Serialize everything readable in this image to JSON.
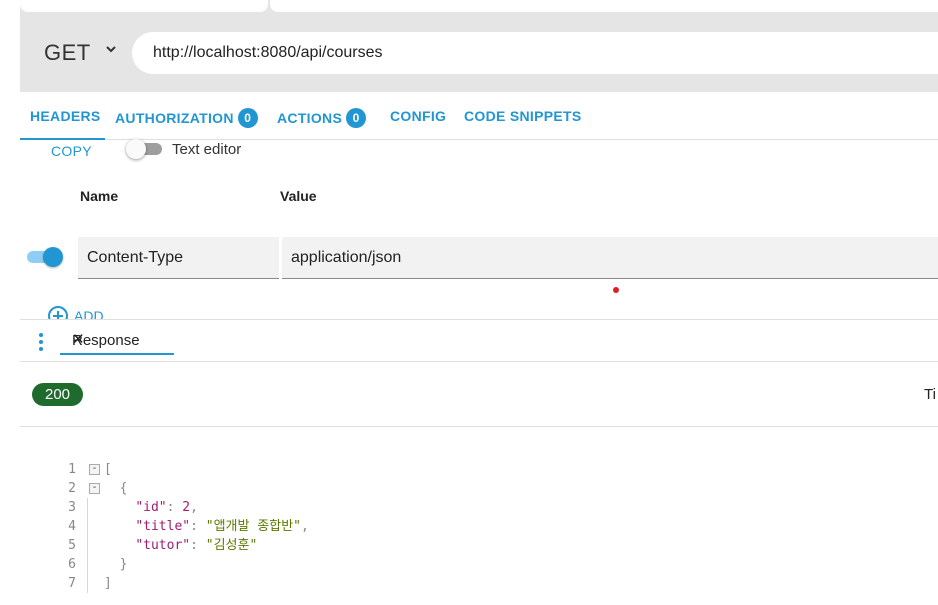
{
  "request": {
    "method": "GET",
    "url": "http://localhost:8080/api/courses"
  },
  "tabs": [
    {
      "label": "HEADERS",
      "badge": null
    },
    {
      "label": "AUTHORIZATION",
      "badge": "0"
    },
    {
      "label": "ACTIONS",
      "badge": "0"
    },
    {
      "label": "CONFIG",
      "badge": null
    },
    {
      "label": "CODE SNIPPETS",
      "badge": null
    }
  ],
  "headers_panel": {
    "copy_label": "COPY",
    "text_editor_label": "Text editor",
    "text_editor_enabled": false,
    "col_name": "Name",
    "col_value": "Value",
    "rows": [
      {
        "enabled": true,
        "name": "Content-Type",
        "value": "application/json"
      }
    ],
    "add_label": "ADD"
  },
  "response": {
    "tab_label": "Response",
    "close_glyph": "✕",
    "status_code": "200",
    "timing_label": "Ti",
    "code_lines": [
      {
        "num": "1",
        "fold": "-",
        "text": "["
      },
      {
        "num": "2",
        "fold": "-",
        "text": "  {"
      },
      {
        "num": "3",
        "fold": "",
        "key": "\"id\"",
        "sep": ": ",
        "val": "2",
        "val_type": "number",
        "tail": ","
      },
      {
        "num": "4",
        "fold": "",
        "key": "\"title\"",
        "sep": ": ",
        "val": "\"앱개발 종합반\"",
        "val_type": "string",
        "tail": ","
      },
      {
        "num": "5",
        "fold": "",
        "key": "\"tutor\"",
        "sep": ": ",
        "val": "\"김성훈\"",
        "val_type": "string",
        "tail": ""
      },
      {
        "num": "6",
        "fold": "",
        "text": "  }"
      },
      {
        "num": "7",
        "fold": "",
        "text": "]"
      }
    ]
  },
  "colors": {
    "accent": "#2196d3",
    "status_ok": "#1f6b2e",
    "json_key": "#a11c70",
    "json_string": "#5a7a00"
  }
}
